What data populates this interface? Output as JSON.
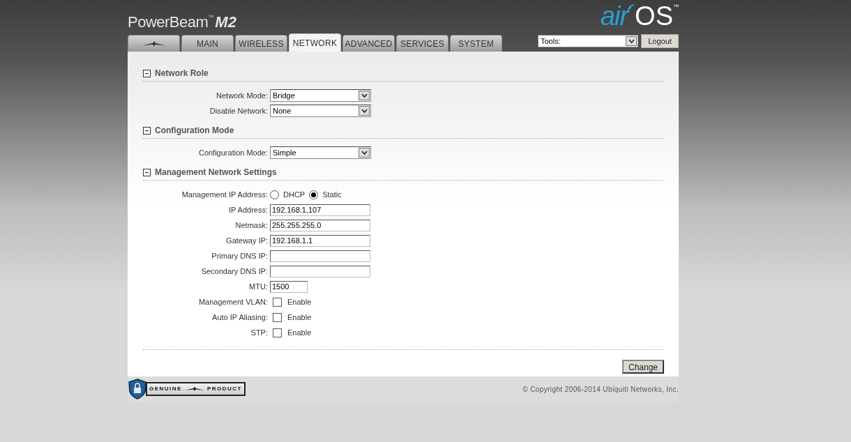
{
  "header": {
    "product": "PowerBeam",
    "product_tm": "™",
    "model": "M2",
    "brand_air": "air",
    "brand_os": "OS",
    "brand_tm": "™"
  },
  "tabs": [
    {
      "kind": "logo",
      "selected": false
    },
    {
      "kind": "text",
      "label": "MAIN",
      "selected": false
    },
    {
      "kind": "text",
      "label": "WIRELESS",
      "selected": false
    },
    {
      "kind": "text",
      "label": "NETWORK",
      "selected": true
    },
    {
      "kind": "text",
      "label": "ADVANCED",
      "selected": false
    },
    {
      "kind": "text",
      "label": "SERVICES",
      "selected": false
    },
    {
      "kind": "text",
      "label": "SYSTEM",
      "selected": false
    }
  ],
  "tools": {
    "value": "Tools:"
  },
  "logout": "Logout",
  "sections": [
    {
      "title": "Network Role",
      "expanded": true,
      "rows": [
        {
          "kind": "select",
          "label": "Network Mode:",
          "value": "Bridge"
        },
        {
          "kind": "select",
          "label": "Disable Network:",
          "value": "None"
        }
      ]
    },
    {
      "title": "Configuration Mode",
      "expanded": true,
      "rows": [
        {
          "kind": "select",
          "label": "Configuration Mode:",
          "value": "Simple"
        }
      ]
    },
    {
      "title": "Management Network Settings",
      "expanded": true,
      "rows": [
        {
          "kind": "radio",
          "label": "Management IP Address:",
          "options": [
            {
              "label": "DHCP",
              "selected": false
            },
            {
              "label": "Static",
              "selected": true
            }
          ]
        },
        {
          "kind": "text",
          "label": "IP Address:",
          "value": "192.168.1.107"
        },
        {
          "kind": "text",
          "label": "Netmask:",
          "value": "255.255.255.0"
        },
        {
          "kind": "text",
          "label": "Gateway IP:",
          "value": "192.168.1.1"
        },
        {
          "kind": "text",
          "label": "Primary DNS IP:"
        },
        {
          "kind": "text",
          "label": "Secondary DNS IP:"
        },
        {
          "kind": "short_text",
          "label": "MTU:",
          "value": "1500"
        },
        {
          "kind": "checkbox",
          "label": "Management VLAN:",
          "option": "Enable",
          "checked": false
        },
        {
          "kind": "checkbox",
          "label": "Auto IP Aliasing:",
          "option": "Enable",
          "checked": false
        },
        {
          "kind": "checkbox",
          "label": "STP:",
          "option": "Enable",
          "checked": false
        }
      ]
    }
  ],
  "change": "Change",
  "badge": {
    "left": "GENUINE",
    "right": "PRODUCT"
  },
  "copyright": "© Copyright 2006-2014 Ubiquiti Networks, Inc."
}
